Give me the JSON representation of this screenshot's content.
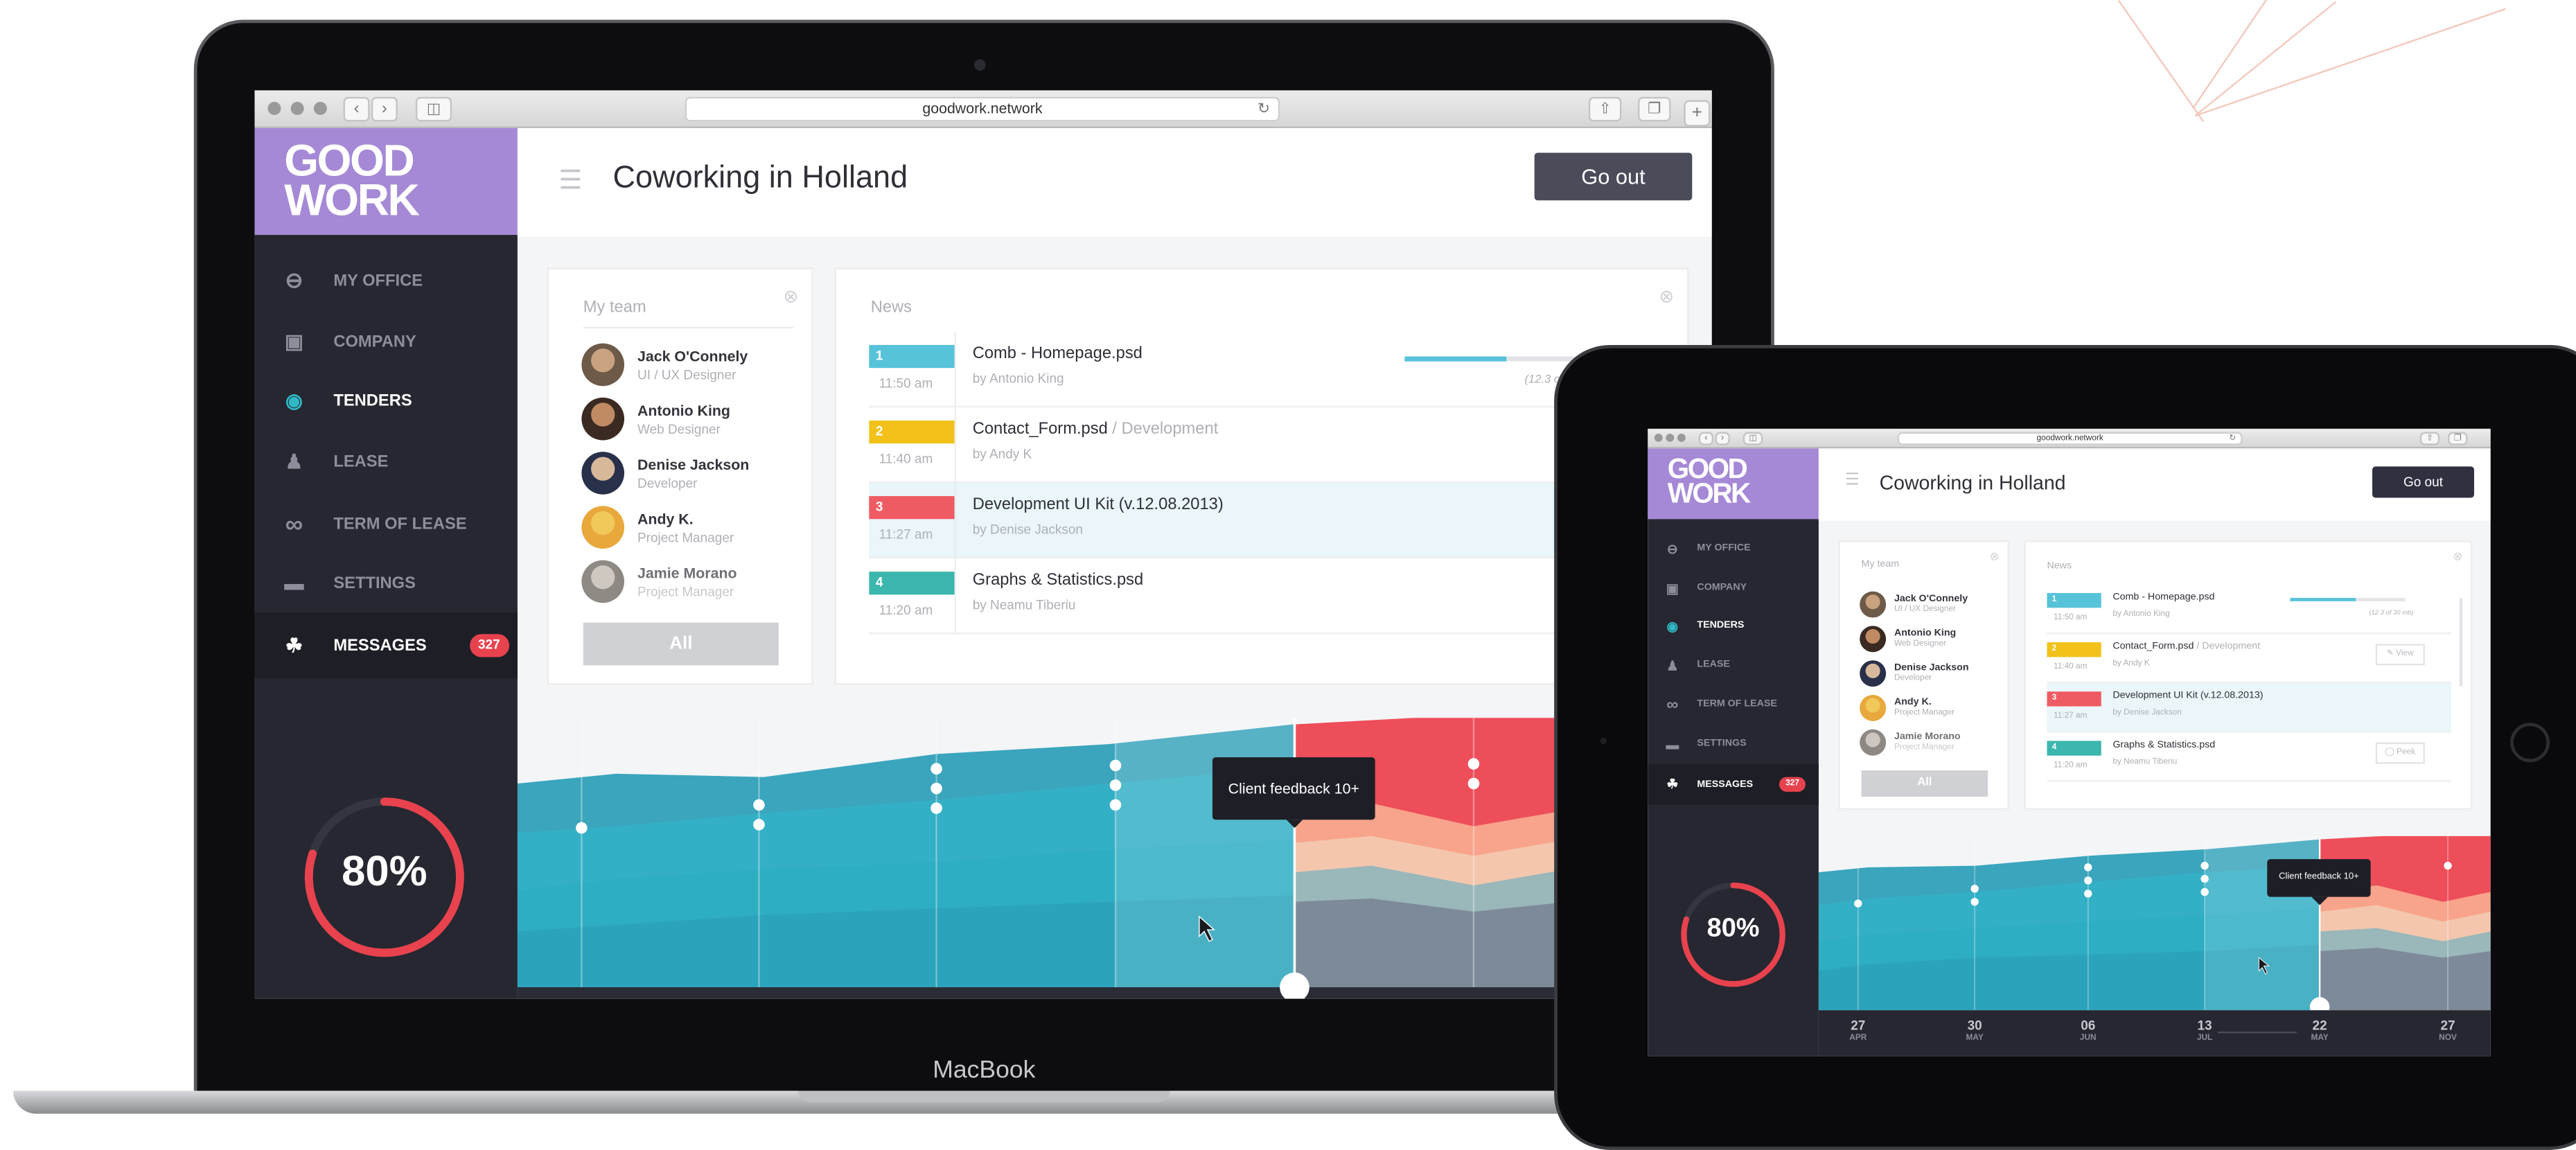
{
  "browser": {
    "url": "goodwork.network"
  },
  "device": {
    "laptop_brand": "MacBook"
  },
  "app": {
    "logo_line1": "GOOD",
    "logo_line2": "WORK",
    "title": "Coworking in Holland",
    "go_out": "Go out",
    "accent": "#a589d6",
    "nav": [
      {
        "label": "MY OFFICE",
        "icon": "office-icon"
      },
      {
        "label": "COMPANY",
        "icon": "image-icon"
      },
      {
        "label": "TENDERS",
        "icon": "eye-icon",
        "active": true
      },
      {
        "label": "LEASE",
        "icon": "person-icon"
      },
      {
        "label": "TERM OF LEASE",
        "icon": "infinity-icon"
      },
      {
        "label": "SETTINGS",
        "icon": "folder-icon"
      },
      {
        "label": "MESSAGES",
        "icon": "message-icon",
        "badge": "327"
      }
    ],
    "progress_text": "80%",
    "progress_value": 0.8,
    "team": {
      "title": "My team",
      "all": "All",
      "members": [
        {
          "name": "Jack O'Connely",
          "role": "UI / UX Designer"
        },
        {
          "name": "Antonio King",
          "role": "Web Designer"
        },
        {
          "name": "Denise Jackson",
          "role": "Developer"
        },
        {
          "name": "Andy K.",
          "role": "Project Manager"
        },
        {
          "name": "Jamie Morano",
          "role": "Project Manager"
        }
      ]
    },
    "news": {
      "title": "News",
      "items": [
        {
          "num": "1",
          "time": "11:50 am",
          "title": "Comb - Homepage.psd",
          "sub": "",
          "by": "by Antonio King",
          "color": "#56c3d9",
          "extra": "(12.3 of 30 mb)"
        },
        {
          "num": "2",
          "time": "11:40 am",
          "title": "Contact_Form.psd",
          "sub": " / Development",
          "by": "by Andy K",
          "color": "#f2c21b",
          "action": "View"
        },
        {
          "num": "3",
          "time": "11:27 am",
          "title": "Development UI Kit (v.12.08.2013)",
          "sub": "",
          "by": "by Denise Jackson",
          "color": "#ef5b63"
        },
        {
          "num": "4",
          "time": "11:20 am",
          "title": "Graphs & Statistics.psd",
          "sub": "",
          "by": "by Neamu Tiberiu",
          "color": "#3bb7ad",
          "action": "Peek"
        }
      ]
    },
    "chart_tooltip": "Client feedback 10+",
    "axis": [
      {
        "day": "27",
        "month": "APR"
      },
      {
        "day": "30",
        "month": "MAY"
      },
      {
        "day": "06",
        "month": "JUN"
      },
      {
        "day": "13",
        "month": "JUL"
      },
      {
        "day": "22",
        "month": "MAY"
      },
      {
        "day": "27",
        "month": "NOV"
      }
    ]
  }
}
